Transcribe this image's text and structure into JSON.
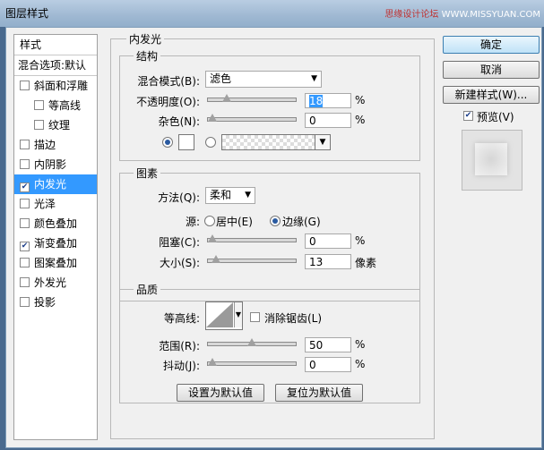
{
  "window": {
    "title": "图层样式",
    "watermark_cn": "思缘设计论坛",
    "watermark_domain": "WWW.MISSYUAN.COM"
  },
  "style_list": {
    "header": "样式",
    "blend_options": "混合选项:默认",
    "items": [
      {
        "label": "斜面和浮雕",
        "checked": false,
        "sub": false,
        "selected": false
      },
      {
        "label": "等高线",
        "checked": false,
        "sub": true,
        "selected": false
      },
      {
        "label": "纹理",
        "checked": false,
        "sub": true,
        "selected": false
      },
      {
        "label": "描边",
        "checked": false,
        "sub": false,
        "selected": false
      },
      {
        "label": "内阴影",
        "checked": false,
        "sub": false,
        "selected": false
      },
      {
        "label": "内发光",
        "checked": true,
        "sub": false,
        "selected": true
      },
      {
        "label": "光泽",
        "checked": false,
        "sub": false,
        "selected": false
      },
      {
        "label": "颜色叠加",
        "checked": false,
        "sub": false,
        "selected": false
      },
      {
        "label": "渐变叠加",
        "checked": true,
        "sub": false,
        "selected": false
      },
      {
        "label": "图案叠加",
        "checked": false,
        "sub": false,
        "selected": false
      },
      {
        "label": "外发光",
        "checked": false,
        "sub": false,
        "selected": false
      },
      {
        "label": "投影",
        "checked": false,
        "sub": false,
        "selected": false
      }
    ]
  },
  "panel": {
    "title": "内发光",
    "structure": {
      "title": "结构",
      "blend_mode_label": "混合模式(B):",
      "blend_mode_value": "滤色",
      "opacity_label": "不透明度(O):",
      "opacity_value": "18",
      "opacity_unit": "%",
      "opacity_fraction": 0.18,
      "noise_label": "杂色(N):",
      "noise_value": "0",
      "noise_unit": "%",
      "noise_fraction": 0.0,
      "fill_color": "#ffffff"
    },
    "elements": {
      "title": "图素",
      "technique_label": "方法(Q):",
      "technique_value": "柔和",
      "source_label": "源:",
      "source_center": "居中(E)",
      "source_edge": "边缘(G)",
      "choke_label": "阻塞(C):",
      "choke_value": "0",
      "choke_unit": "%",
      "choke_fraction": 0.0,
      "size_label": "大小(S):",
      "size_value": "13",
      "size_unit": "像素",
      "size_fraction": 0.05
    },
    "quality": {
      "title": "品质",
      "contour_label": "等高线:",
      "anti_alias_label": "消除锯齿(L)",
      "range_label": "范围(R):",
      "range_value": "50",
      "range_unit": "%",
      "range_fraction": 0.5,
      "jitter_label": "抖动(J):",
      "jitter_value": "0",
      "jitter_unit": "%",
      "jitter_fraction": 0.0
    },
    "make_default": "设置为默认值",
    "reset_default": "复位为默认值"
  },
  "right": {
    "ok": "确定",
    "cancel": "取消",
    "new_style": "新建样式(W)...",
    "preview_label": "预览(V)",
    "preview_checked": true
  }
}
